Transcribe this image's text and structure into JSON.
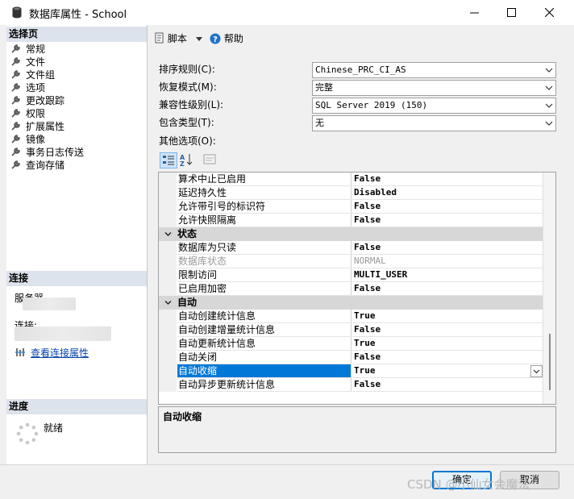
{
  "window": {
    "title": "数据库属性 - School",
    "min_icon": "minimize-icon",
    "max_icon": "maximize-icon",
    "close_icon": "close-icon"
  },
  "left_panel": {
    "select_page_header": "选择页",
    "pages": [
      "常规",
      "文件",
      "文件组",
      "选项",
      "更改跟踪",
      "权限",
      "扩展属性",
      "镜像",
      "事务日志传送",
      "查询存储"
    ],
    "connection_header": "连接",
    "server_label": "服务器",
    "connection_label": "连接:",
    "view_connection_link": "查看连接属性",
    "progress_header": "进度",
    "progress_status": "就绪"
  },
  "toolbar": {
    "script_label": "脚本",
    "help_label": "帮助"
  },
  "options": {
    "collation_label": "排序规则(C):",
    "collation_value": "Chinese_PRC_CI_AS",
    "recovery_label": "恢复模式(M):",
    "recovery_value": "完整",
    "compat_label": "兼容性级别(L):",
    "compat_value": "SQL Server 2019 (150)",
    "containment_label": "包含类型(T):",
    "containment_value": "无",
    "other_label": "其他选项(O):"
  },
  "grid": {
    "rows_a": [
      {
        "name": "算术中止已启用",
        "value": "False"
      },
      {
        "name": "延迟持久性",
        "value": "Disabled"
      },
      {
        "name": "允许带引号的标识符",
        "value": "False"
      },
      {
        "name": "允许快照隔离",
        "value": "False"
      }
    ],
    "cat_state": "状态",
    "rows_b": [
      {
        "name": "数据库为只读",
        "value": "False"
      },
      {
        "name": "数据库状态",
        "value": "NORMAL"
      },
      {
        "name": "限制访问",
        "value": "MULTI_USER"
      },
      {
        "name": "已启用加密",
        "value": "False"
      }
    ],
    "cat_auto": "自动",
    "rows_c": [
      {
        "name": "自动创建统计信息",
        "value": "True"
      },
      {
        "name": "自动创建增量统计信息",
        "value": "False"
      },
      {
        "name": "自动更新统计信息",
        "value": "True"
      },
      {
        "name": "自动关闭",
        "value": "False"
      },
      {
        "name": "自动收缩",
        "value": "True"
      },
      {
        "name": "自动异步更新统计信息",
        "value": "False"
      }
    ]
  },
  "description": {
    "title": "自动收缩"
  },
  "buttons": {
    "ok": "确定",
    "cancel": "取消"
  },
  "watermark": "CSDN @小仙女会魔法"
}
